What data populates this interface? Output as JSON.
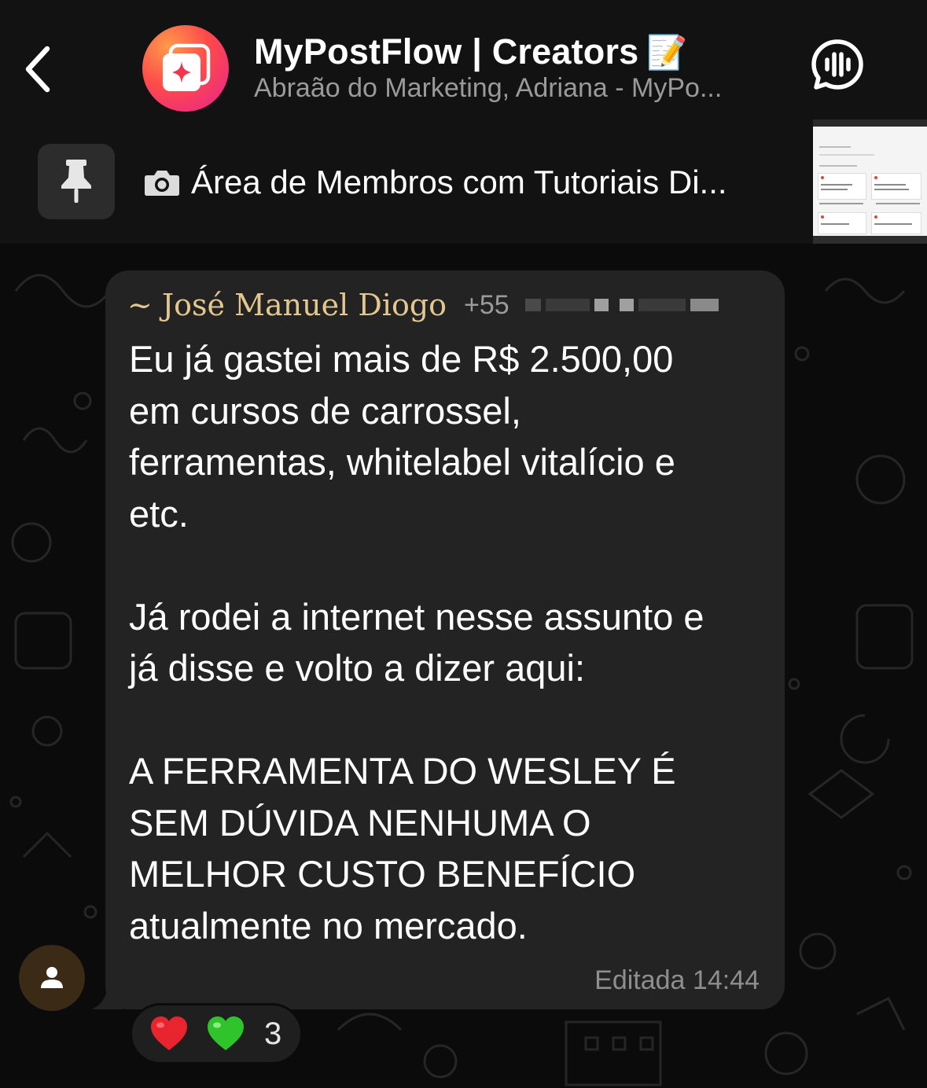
{
  "header": {
    "title": "MyPostFlow | Creators",
    "title_emoji": "📝",
    "subtitle": "Abraão do Marketing, Adriana - MyPo...",
    "back_icon": "chevron-left-icon",
    "call_icon": "voice-chat-icon"
  },
  "pinned": {
    "icon": "pin-icon",
    "media_icon": "camera-icon",
    "text": "Área de Membros com Tutoriais Di..."
  },
  "message": {
    "sender_name": "~ José Manuel Diogo",
    "sender_phone": "+55",
    "text": "Eu já gastei mais de R$ 2.500,00\nem cursos de carrossel,\nferramentas, whitelabel vitalício e\netc.\n\nJá rodei a internet nesse assunto e\njá disse e volto a dizer aqui:\n\nA FERRAMENTA DO WESLEY É\nSEM DÚVIDA NENHUMA O\nMELHOR CUSTO BENEFÍCIO\natualmente no mercado.",
    "meta": "Editada 14:44"
  },
  "reactions": {
    "items": [
      "red-heart-emoji",
      "green-heart-emoji"
    ],
    "count": "3"
  },
  "colors": {
    "sender_name": "#e4c78f",
    "bubble": "#232323",
    "header_bg": "#121212"
  }
}
